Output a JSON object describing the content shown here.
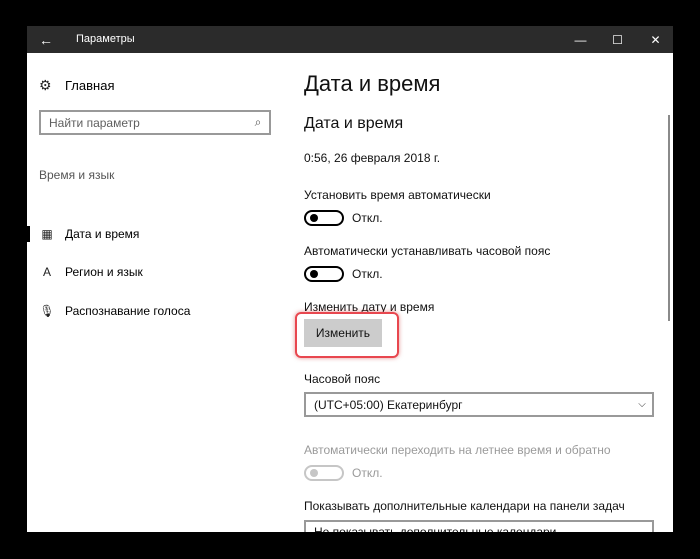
{
  "window": {
    "title": "Параметры",
    "back_icon": "←",
    "minimize_icon": "—",
    "maximize_icon": "☐",
    "close_icon": "✕"
  },
  "sidebar": {
    "home_label": "Главная",
    "home_icon": "⚙",
    "search_placeholder": "Найти параметр",
    "search_icon": "⌕",
    "section_label": "Время и язык",
    "items": [
      {
        "label": "Дата и время",
        "icon": "▦",
        "selected": true
      },
      {
        "label": "Регион и язык",
        "icon": "A",
        "selected": false
      },
      {
        "label": "Распознавание голоса",
        "icon": "🎙",
        "selected": false
      }
    ]
  },
  "main": {
    "page_title": "Дата и время",
    "section_title": "Дата и время",
    "current_datetime": "0:56, 26 февраля 2018 г.",
    "auto_time_label": "Установить время автоматически",
    "auto_time_state": "Откл.",
    "auto_tz_label": "Автоматически устанавливать часовой пояс",
    "auto_tz_state": "Откл.",
    "change_dt_label": "Изменить дату и время",
    "change_button": "Изменить",
    "timezone_label": "Часовой пояс",
    "timezone_value": "(UTC+05:00) Екатеринбург",
    "dst_label": "Автоматически переходить на летнее время и обратно",
    "dst_state": "Откл.",
    "calendars_label": "Показывать дополнительные календари на панели задач",
    "calendars_value": "Не показывать дополнительные календари"
  },
  "colors": {
    "titlebar": "#2b2b2b",
    "highlight": "#e8474f",
    "button": "#cccccc"
  }
}
